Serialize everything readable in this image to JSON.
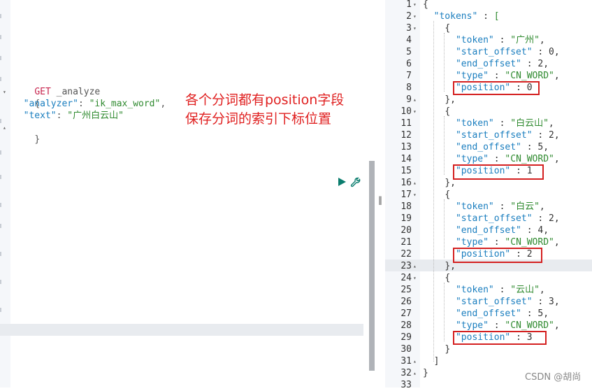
{
  "request": {
    "lines": [
      {
        "method": "GET",
        "rest": " _analyze"
      },
      {
        "text": "{"
      },
      {
        "key": "\"analyzer\"",
        "sep": ": ",
        "val": "\"ik_max_word\"",
        "end": ","
      },
      {
        "key": "\"text\"",
        "sep": ": ",
        "val": "\"广州白云山\"",
        "end": ""
      },
      {
        "text": "}"
      }
    ]
  },
  "annotation": {
    "line1": "各个分词都有position字段",
    "line2": "保存分词的索引下标位置"
  },
  "icons": {
    "run": "play-icon",
    "wrench": "wrench-icon",
    "resize": "resize-handle-icon"
  },
  "resize_glyph": "‖",
  "response": {
    "lines": [
      {
        "n": "1",
        "fold": "▾",
        "text": "{"
      },
      {
        "n": "2",
        "fold": "▾",
        "indent": "  ",
        "key": "\"tokens\"",
        "sep": " : ",
        "val": "["
      },
      {
        "n": "3",
        "fold": "▾",
        "indent": "    ",
        "text": "{"
      },
      {
        "n": "4",
        "indent": "      ",
        "key": "\"token\"",
        "sep": " : ",
        "val": "\"广州\"",
        "end": ","
      },
      {
        "n": "5",
        "indent": "      ",
        "key": "\"start_offset\"",
        "sep": " : ",
        "num": "0",
        "end": ","
      },
      {
        "n": "6",
        "indent": "      ",
        "key": "\"end_offset\"",
        "sep": " : ",
        "num": "2",
        "end": ","
      },
      {
        "n": "7",
        "indent": "      ",
        "key": "\"type\"",
        "sep": " : ",
        "val": "\"CN_WORD\"",
        "end": ","
      },
      {
        "n": "8",
        "indent": "      ",
        "key": "\"position\"",
        "sep": " : ",
        "num": "0",
        "end": ""
      },
      {
        "n": "9",
        "fold": "▴",
        "indent": "    ",
        "text": "},"
      },
      {
        "n": "10",
        "fold": "▾",
        "indent": "    ",
        "text": "{"
      },
      {
        "n": "11",
        "indent": "      ",
        "key": "\"token\"",
        "sep": " : ",
        "val": "\"白云山\"",
        "end": ","
      },
      {
        "n": "12",
        "indent": "      ",
        "key": "\"start_offset\"",
        "sep": " : ",
        "num": "2",
        "end": ","
      },
      {
        "n": "13",
        "indent": "      ",
        "key": "\"end_offset\"",
        "sep": " : ",
        "num": "5",
        "end": ","
      },
      {
        "n": "14",
        "indent": "      ",
        "key": "\"type\"",
        "sep": " : ",
        "val": "\"CN_WORD\"",
        "end": ","
      },
      {
        "n": "15",
        "indent": "      ",
        "key": "\"position\"",
        "sep": " : ",
        "num": "1",
        "end": ""
      },
      {
        "n": "16",
        "fold": "▴",
        "indent": "    ",
        "text": "},"
      },
      {
        "n": "17",
        "fold": "▾",
        "indent": "    ",
        "text": "{"
      },
      {
        "n": "18",
        "indent": "      ",
        "key": "\"token\"",
        "sep": " : ",
        "val": "\"白云\"",
        "end": ","
      },
      {
        "n": "19",
        "indent": "      ",
        "key": "\"start_offset\"",
        "sep": " : ",
        "num": "2",
        "end": ","
      },
      {
        "n": "20",
        "indent": "      ",
        "key": "\"end_offset\"",
        "sep": " : ",
        "num": "4",
        "end": ","
      },
      {
        "n": "21",
        "indent": "      ",
        "key": "\"type\"",
        "sep": " : ",
        "val": "\"CN_WORD\"",
        "end": ","
      },
      {
        "n": "22",
        "indent": "      ",
        "key": "\"position\"",
        "sep": " : ",
        "num": "2",
        "end": ""
      },
      {
        "n": "23",
        "fold": "▴",
        "indent": "    ",
        "text": "},"
      },
      {
        "n": "24",
        "fold": "▾",
        "indent": "    ",
        "text": "{"
      },
      {
        "n": "25",
        "indent": "      ",
        "key": "\"token\"",
        "sep": " : ",
        "val": "\"云山\"",
        "end": ","
      },
      {
        "n": "26",
        "indent": "      ",
        "key": "\"start_offset\"",
        "sep": " : ",
        "num": "3",
        "end": ","
      },
      {
        "n": "27",
        "indent": "      ",
        "key": "\"end_offset\"",
        "sep": " : ",
        "num": "5",
        "end": ","
      },
      {
        "n": "28",
        "indent": "      ",
        "key": "\"type\"",
        "sep": " : ",
        "val": "\"CN_WORD\"",
        "end": ","
      },
      {
        "n": "29",
        "indent": "      ",
        "key": "\"position\"",
        "sep": " : ",
        "num": "3",
        "end": ""
      },
      {
        "n": "30",
        "indent": "    ",
        "text": "}"
      },
      {
        "n": "31",
        "fold": "▴",
        "indent": "  ",
        "text": "]"
      },
      {
        "n": "32",
        "fold": "▴",
        "text": "}"
      },
      {
        "n": "33",
        "text": ""
      }
    ]
  },
  "watermark": "CSDN @胡尚"
}
